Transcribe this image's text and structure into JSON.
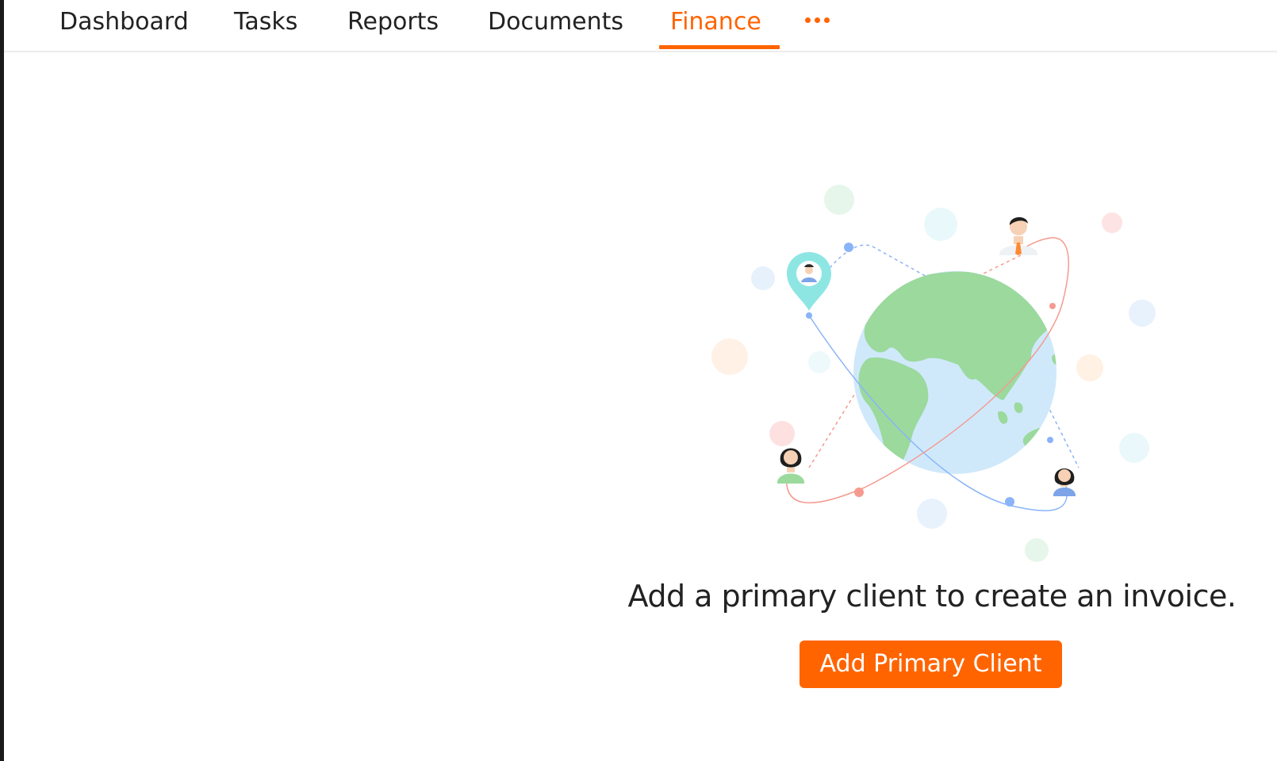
{
  "tabs": [
    {
      "label": "Dashboard",
      "active": false
    },
    {
      "label": "Tasks",
      "active": false
    },
    {
      "label": "Reports",
      "active": false
    },
    {
      "label": "Documents",
      "active": false
    },
    {
      "label": "Finance",
      "active": true
    }
  ],
  "more_menu_icon": "more-horizontal-icon",
  "empty_state": {
    "illustration": "globe-with-clients-illustration",
    "message": "Add a primary client to create an invoice.",
    "button_label": "Add Primary Client"
  },
  "colors": {
    "accent": "#ff6400",
    "text": "#222222",
    "globe_ocean": "#cfe9fb",
    "globe_land": "#9bd99d",
    "pin": "#8ee6e3"
  }
}
